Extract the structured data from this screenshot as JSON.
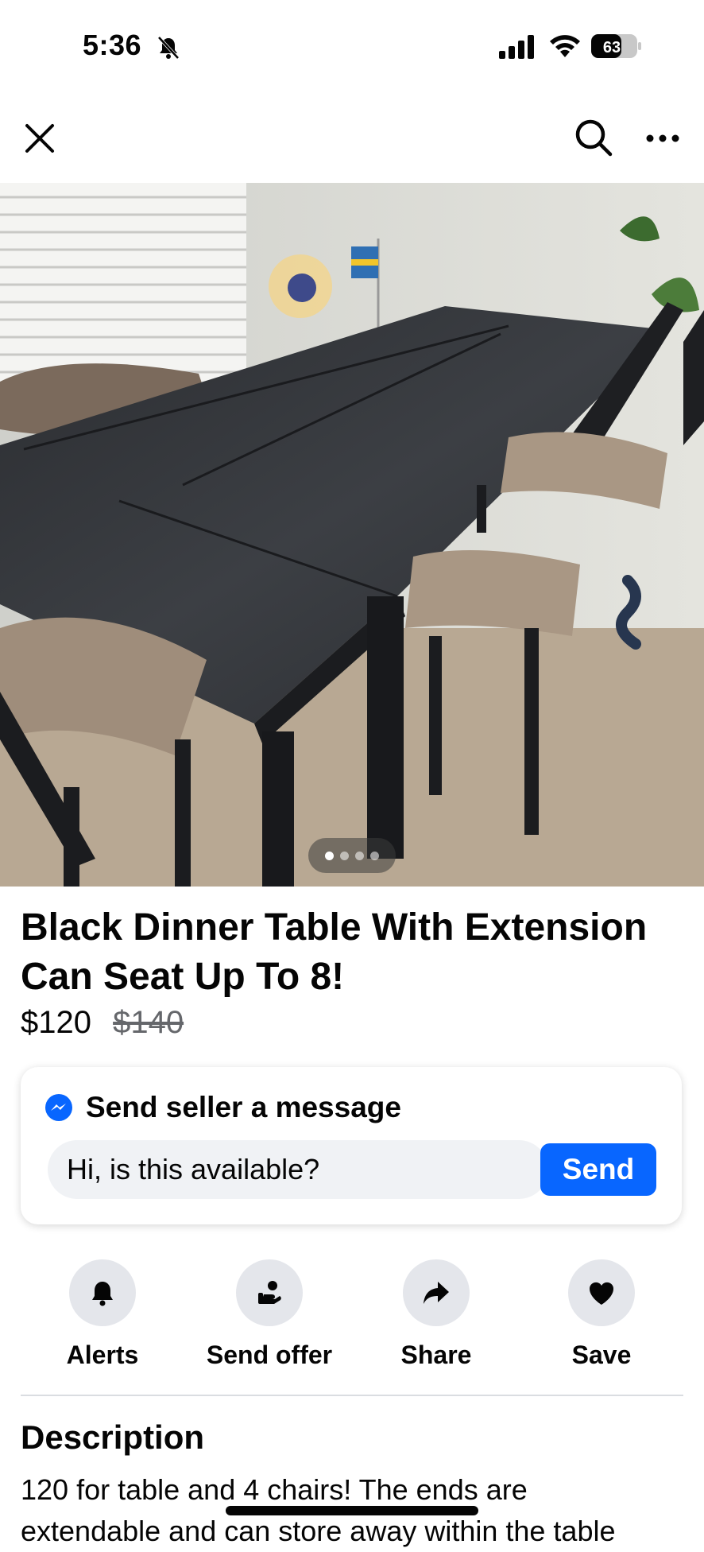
{
  "status_bar": {
    "time": "5:36",
    "battery": "63"
  },
  "listing": {
    "title": "Black Dinner Table With Extension Can Seat Up To 8!",
    "price": "$120",
    "original_price": "$140",
    "photo_count": 4,
    "active_photo": 1
  },
  "message": {
    "heading": "Send seller a message",
    "input_value": "Hi, is this available?",
    "send_label": "Send"
  },
  "actions": [
    {
      "label": "Alerts",
      "icon": "bell-icon"
    },
    {
      "label": "Send offer",
      "icon": "offer-icon"
    },
    {
      "label": "Share",
      "icon": "share-icon"
    },
    {
      "label": "Save",
      "icon": "heart-icon"
    }
  ],
  "description": {
    "heading": "Description",
    "text": "120 for table and 4 chairs! The ends are extendable and can store away within the table"
  },
  "colors": {
    "accent": "#0866ff",
    "text": "#050505",
    "secondary_text": "#65676b",
    "chip_bg": "#e4e6eb"
  }
}
